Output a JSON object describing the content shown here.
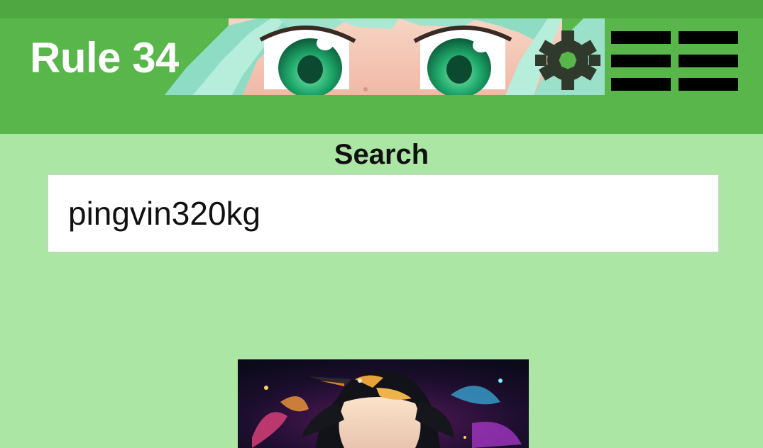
{
  "header": {
    "site_title": "Rule 34",
    "banner_icon": "anime-eyes-banner",
    "settings_icon": "gear-icon",
    "menu_icon_1": "hamburger-menu-icon",
    "menu_icon_2": "hamburger-menu-icon"
  },
  "search": {
    "label": "Search",
    "value": "pingvin320kg"
  },
  "results": {
    "thumbnail_icon": "penguin-artwork-image"
  },
  "colors": {
    "header_bg": "#58b64b",
    "page_bg": "#abe6a5",
    "title_text": "#ffffff"
  }
}
